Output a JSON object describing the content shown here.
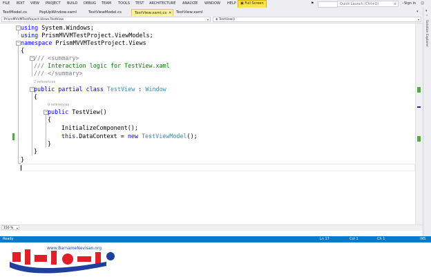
{
  "menu": {
    "items": [
      "FILE",
      "EDIT",
      "VIEW",
      "PROJECT",
      "BUILD",
      "DEBUG",
      "TEAM",
      "TOOLS",
      "TEST",
      "ARCHITECTURE",
      "ANALYZE",
      "WINDOW",
      "HELP"
    ],
    "full_screen": "Full Screen",
    "quick_launch_placeholder": "Quick Launch (Ctrl+Q)",
    "sign_in": "Sign in"
  },
  "tabs": [
    {
      "label": "TestModel.cs",
      "active": false
    },
    {
      "label": "PopUpWindow.xaml",
      "active": false
    },
    {
      "label": "TestViewModel.cs",
      "active": false
    },
    {
      "label": "TestView.xaml.cs",
      "active": true
    },
    {
      "label": "TestView.xaml",
      "active": false
    }
  ],
  "navbar": {
    "type_dropdown": "PrismMVVMTestProject.Views.TestView",
    "member_dropdown": "TestView()"
  },
  "side_panel": {
    "label": "Solution Explorer"
  },
  "code": {
    "line1": {
      "kw": "using",
      "rest": " System.Windows;"
    },
    "line2": {
      "kw": "using",
      "rest": " PrismMVVMTestProject.ViewModels;"
    },
    "line3": {
      "kw": "namespace",
      "rest": " PrismMVVMTestProject.Views"
    },
    "line4": "{",
    "line5": {
      "slashes": "///",
      "tag": " <summary>"
    },
    "line6": {
      "slashes": "///",
      "text": " Interaction logic for TestView.xaml"
    },
    "line7": {
      "slashes": "///",
      "tag": " </summary>"
    },
    "refs_class": "2 references",
    "line8": {
      "kw1": "public",
      "kw2": " partial",
      "kw3": " class",
      "type": " TestView",
      "sep": " : ",
      "base": "Window"
    },
    "line9": "{",
    "refs_ctor": "0 references",
    "line10": {
      "kw": "public",
      "rest": " TestView()"
    },
    "line11": "{",
    "line12": "InitializeComponent();",
    "line13": {
      "kw_this": "this",
      "mid": ".DataContext = ",
      "kw_new": "new",
      "type": " TestViewModel",
      "end": "();"
    },
    "line14": "}",
    "line15": "}",
    "line16": "}"
  },
  "zoom": "150 %",
  "status": {
    "state": "Ready",
    "ln": "Ln 17",
    "col": "Col 1",
    "ch": "Ch 1",
    "mode": "INS"
  },
  "logo": {
    "url": "www.BarnameNevisan.org",
    "wordmark": "برنامه‌نویسان"
  },
  "colors": {
    "accent": "#007acc",
    "active_tab": "#fff29d",
    "keyword": "#0000ff",
    "type": "#2b91af",
    "comment": "#008000",
    "logo_blue": "#1f3f9e",
    "logo_red": "#e21f26"
  }
}
